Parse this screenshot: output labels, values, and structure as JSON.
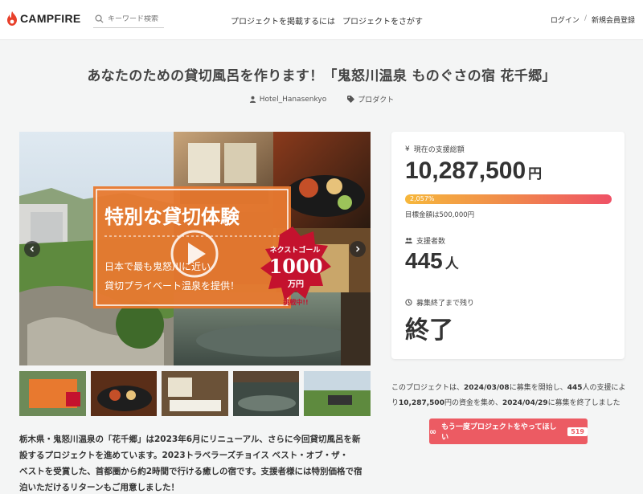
{
  "header": {
    "logo": "CAMPFIRE",
    "search_placeholder": "キーワード検索",
    "nav": [
      "プロジェクトを掲載するには",
      "プロジェクトをさがす"
    ],
    "login": "ログイン",
    "separator": "/",
    "signup": "新規会員登録"
  },
  "project": {
    "title": "あなたのための貸切風呂を作ります！「鬼怒川温泉 ものぐさの宿 花千郷」",
    "owner": "Hotel_Hanasenkyo",
    "category": "プロダクト"
  },
  "hero": {
    "headline": "特別な貸切体験",
    "sub1": "日本で最も鬼怒川に近い",
    "sub2": "貸切プライベート温泉を提供！",
    "badge_top": "ネクストゴール",
    "badge_num": "1000",
    "badge_unit": "万円",
    "badge_bottom": "挑戦中!!"
  },
  "stats": {
    "total_label": "現在の支援総額",
    "total_value": "10,287,500",
    "total_unit": "円",
    "progress_text": "2,057%",
    "progress_fraction": 1.0,
    "goal_text": "目標金額は500,000円",
    "backers_label": "支援者数",
    "backers_value": "445",
    "backers_unit": "人",
    "remaining_label": "募集終了まで残り",
    "remaining_value": "終了"
  },
  "summary": {
    "p1": "このプロジェクトは、",
    "start": "2024/03/08",
    "p2": "に募集を開始し、",
    "backers": "445",
    "p3": "人の支援により",
    "amount": "10,287,500",
    "p4": "円の資金を集め、",
    "end": "2024/04/29",
    "p5": "に募集を終了しました"
  },
  "again_button": {
    "label": "もう一度プロジェクトをやってほしい",
    "count": "519"
  },
  "description": {
    "line1": "栃木県・鬼怒川温泉の「花千郷」は2023年6月にリニューアル、さらに今回貸切風呂を新",
    "line2": "設するプロジェクトを進めています。2023トラベラーズチョイス ベスト・オブ・ザ・",
    "line3": "ベストを受賞した、首都圏から約2時間で行ける癒しの宿です。支援者様には特別価格で宿",
    "line4": "泊いただけるリターンもご用意しました！"
  },
  "colors": {
    "brand": "#e8402b",
    "accent": "#ec5b63",
    "orange_panel": "#e8792f"
  }
}
